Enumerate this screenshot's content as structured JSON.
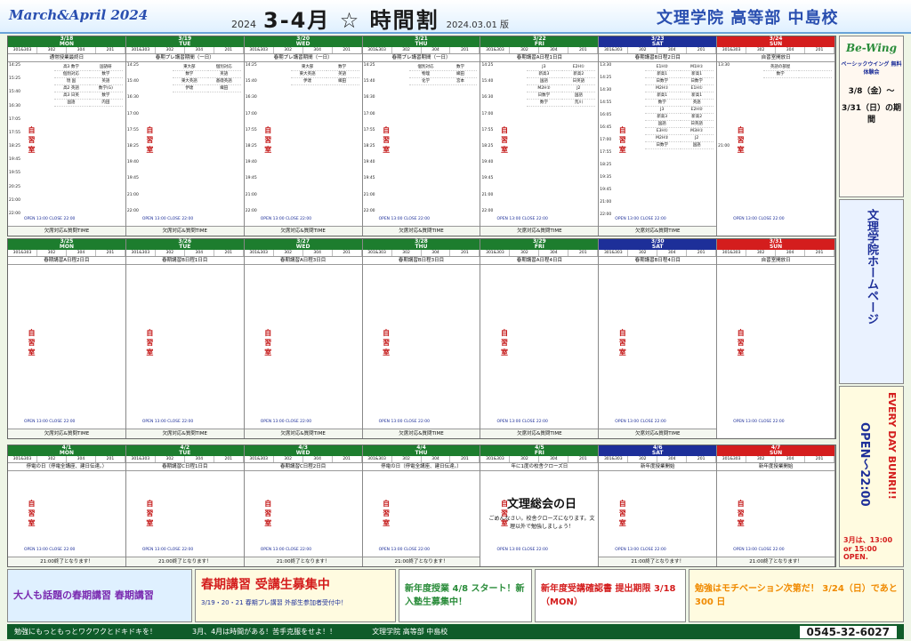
{
  "header": {
    "left": "March&April 2024",
    "year": "2024",
    "title": "3-4月 ☆ 時間割",
    "version": "2024.03.01 版",
    "school": "文理学院 高等部 中島校"
  },
  "rooms": [
    "301&303",
    "302",
    "304",
    "201"
  ],
  "jishu": "自習室",
  "wing": {
    "name": "Be-Wing",
    "sub": "ベーシックウイング",
    "free": "無料体験会"
  },
  "open_text": "OPEN 13:00 CLOSE 22:00",
  "week1": [
    {
      "date": "3/18",
      "dow": "MON",
      "note": "通常授業最終日",
      "foot": "欠席対応&質問TIME",
      "times": [
        "14:25",
        "15:25",
        "15:40",
        "16:30",
        "17:05",
        "17:55",
        "18:25",
        "19:45",
        "19:55",
        "20:25",
        "21:00",
        "22:00"
      ],
      "cells": [
        [
          "高3 数学",
          "国語研"
        ],
        [
          "個別対応",
          "数学"
        ],
        [
          "現 国",
          "英語"
        ],
        [
          "高2 英語",
          "数学(G)"
        ],
        [
          "高3 日英",
          "数学"
        ],
        [
          "国語",
          "内田"
        ]
      ]
    },
    {
      "date": "3/19",
      "dow": "TUE",
      "note": "春期プレ講習期間（一日）",
      "foot": "欠席対応&質問TIME",
      "times": [
        "14:25",
        "15:40",
        "16:30",
        "17:00",
        "17:55",
        "18:25",
        "19:40",
        "19:45",
        "21:00",
        "22:00"
      ],
      "cells": [
        [
          "東大部",
          "個別対応"
        ],
        [
          "数学",
          "英語"
        ],
        [
          "東大英語",
          "基礎英語"
        ],
        [
          "伊達",
          "織田"
        ]
      ]
    },
    {
      "date": "3/20",
      "dow": "WED",
      "note": "春期プレ講習期間（一日）",
      "foot": "欠席対応&質問TIME",
      "times": [
        "14:25",
        "15:40",
        "16:30",
        "17:00",
        "17:55",
        "18:25",
        "19:40",
        "19:45",
        "21:00",
        "22:00"
      ],
      "cells": [
        [
          "東大部",
          "数学"
        ],
        [
          "東大英語",
          "英語"
        ],
        [
          "伊達",
          "織田"
        ]
      ]
    },
    {
      "date": "3/21",
      "dow": "THU",
      "note": "春期プレ講習期間（一日）",
      "foot": "欠席対応&質問TIME",
      "times": [
        "14:25",
        "15:40",
        "16:30",
        "17:00",
        "17:55",
        "18:25",
        "19:40",
        "19:45",
        "21:00",
        "22:00"
      ],
      "cells": [
        [
          "個別対応",
          "数学"
        ],
        [
          "物理",
          "織田"
        ],
        [
          "化学",
          "宮本"
        ]
      ]
    },
    {
      "date": "3/22",
      "dow": "FRI",
      "note": "春期講習A日程1日目",
      "foot": "欠席対応&質問TIME",
      "times": [
        "14:25",
        "15:40",
        "16:30",
        "17:00",
        "17:55",
        "18:25",
        "19:40",
        "19:45",
        "21:00",
        "22:00"
      ],
      "cells": [
        [
          "J3",
          "E2H①"
        ],
        [
          "新高3",
          "新高2"
        ],
        [
          "国語",
          "日英語"
        ],
        [
          "M2H②",
          "J2"
        ],
        [
          "日数学",
          "国語"
        ],
        [
          "数学",
          "荒川"
        ]
      ]
    },
    {
      "date": "3/23",
      "dow": "SAT",
      "note": "春期講習B日程2日目",
      "foot": "欠席対応&質問TIME",
      "times": [
        "13:30",
        "14:25",
        "14:30",
        "14:55",
        "16:05",
        "16:45",
        "17:00",
        "17:55",
        "18:25",
        "19:35",
        "19:45",
        "21:00",
        "22:00"
      ],
      "cells": [
        [
          "E1H②",
          "M1H①"
        ],
        [
          "新高1",
          "新高1"
        ],
        [
          "日数学",
          "日数学"
        ],
        [
          "M2H①",
          "E1H①"
        ],
        [
          "新高1",
          "新高1"
        ],
        [
          "数学",
          "英語"
        ],
        [
          "J3",
          "E2H②"
        ],
        [
          "新高3",
          "新高2"
        ],
        [
          "国語",
          "日英語"
        ],
        [
          "E3H①",
          "M3H①"
        ],
        [
          "M2H②",
          "J2"
        ],
        [
          "日数学",
          "国語"
        ]
      ]
    },
    {
      "date": "3/24",
      "dow": "SUN",
      "note": "自習室開放日",
      "foot": "",
      "times": [
        "13:30",
        "21:00"
      ],
      "cells": [
        [
          "英語の部屋",
          ""
        ],
        [
          "数学",
          ""
        ]
      ]
    }
  ],
  "week2": [
    {
      "date": "3/25",
      "dow": "MON",
      "note": "春期講習A日程2日目",
      "foot": "欠席対応&質問TIME"
    },
    {
      "date": "3/26",
      "dow": "TUE",
      "note": "春期講習B日程1日目",
      "foot": "欠席対応&質問TIME"
    },
    {
      "date": "3/27",
      "dow": "WED",
      "note": "春期講習A日程3日目",
      "foot": "欠席対応&質問TIME"
    },
    {
      "date": "3/28",
      "dow": "THU",
      "note": "春期講習B日程3日目",
      "foot": "欠席対応&質問TIME"
    },
    {
      "date": "3/29",
      "dow": "FRI",
      "note": "春期講習A日程4日目",
      "foot": "欠席対応&質問TIME"
    },
    {
      "date": "3/30",
      "dow": "SAT",
      "note": "春期講習B日程4日目",
      "foot": "欠席対応&質問TIME"
    },
    {
      "date": "3/31",
      "dow": "SUN",
      "note": "自習室開放日",
      "foot": ""
    }
  ],
  "week3": [
    {
      "date": "4/1",
      "dow": "MON",
      "note": "停電の日（停電全講座、建日伝達。）",
      "foot": "21:00終了となります！"
    },
    {
      "date": "4/2",
      "dow": "TUE",
      "note": "春期講習C日程1日目",
      "foot": "21:00終了となります！"
    },
    {
      "date": "4/3",
      "dow": "WED",
      "note": "春期講習C日程2日目",
      "foot": "21:00終了となります！"
    },
    {
      "date": "4/4",
      "dow": "THU",
      "note": "停電の日（停電全講座、建日伝達。）",
      "foot": "21:00終了となります！"
    },
    {
      "date": "4/5",
      "dow": "FRI",
      "note": "年に1度の校舎クローズ日",
      "foot": ""
    },
    {
      "date": "4/6",
      "dow": "SAT",
      "note": "新年度授業開始",
      "foot": "21:00終了となります！"
    },
    {
      "date": "4/7",
      "dow": "SUN",
      "note": "新年度授業開始",
      "foot": "21:00終了となります！"
    }
  ],
  "closure": {
    "title": "文理総会の日",
    "msg": "ごめんなさい。校舎クローズになります。文理以外で勉強しましょう！"
  },
  "side": {
    "top": "Be-Wing",
    "top_sub": "ベーシックウイング 無料体験会",
    "date1": "3/8（金）〜",
    "date2": "3/31（日）の期間",
    "hp": "文理学院ホームページ",
    "every": "EVERY DAY BUNRI!!",
    "open": "OPEN〜22:00",
    "mar": "3月は、13:00 or 15:00 OPEN."
  },
  "bottom": {
    "p1": "大人も話題の春期講習 春期講習",
    "p2": "春期講習 受講生募集中",
    "p2b": "3/19・20・21 春期プレ講習 外部生参加者受付中！",
    "p3": "新年度授業 4/8 スタート！新入塾生募集中！",
    "p4": "新年度受講確認書 提出期限 3/18（MON）",
    "p5": "勉強はモチベーション次第だ！ 3/24（日）であと 300 日"
  },
  "footer": {
    "left": "勉強にもっともっとワクワクとドキドキを！",
    "mid": "3月、4月は時間がある！苦手克服をせよ！！",
    "right": "文理学院 高等部 中島校",
    "tel": "0545-32-6027"
  }
}
